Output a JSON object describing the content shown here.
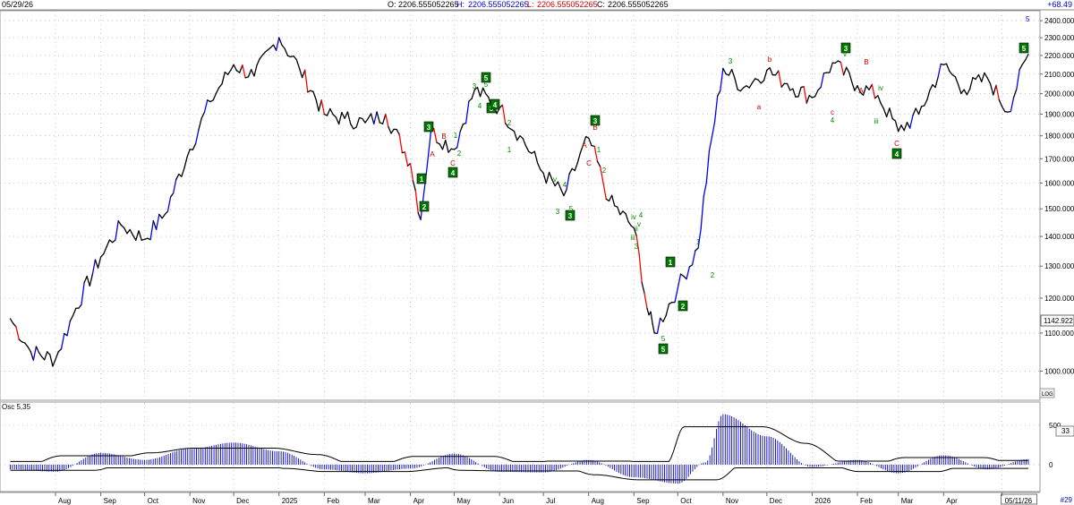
{
  "header": {
    "date": "05/29/26",
    "open_label": "O:",
    "open": "2206.555052265",
    "high_label": "H:",
    "high": "2206.555052265",
    "low_label": "L:",
    "low": "2206.555052265",
    "close_label": "C:",
    "close": "2206.555052265",
    "change": "+68.49"
  },
  "colors": {
    "up": "#0000ff",
    "down": "#ff0000",
    "neutral": "#000000",
    "wave_box": "#007700",
    "wave_green": "#008800",
    "wave_red": "#cc0000",
    "osc": "#0000cc",
    "grid": "#b8b8b8"
  },
  "price_panel": {
    "last_price_label": "1142.922",
    "log_badge": "LOG",
    "top_right_marker": "5",
    "right_edge": "+68.49"
  },
  "osc_panel": {
    "title": "Osc 5,35",
    "value_label": "33",
    "bottom_right": "#29"
  },
  "x_axis": {
    "labels": [
      "Aug",
      "Sep",
      "Oct",
      "Nov",
      "Dec",
      "2025",
      "Feb",
      "Mar",
      "Apr",
      "May",
      "Jun",
      "Jul",
      "Aug",
      "Sep",
      "Oct",
      "Nov",
      "Dec",
      "2026",
      "Feb",
      "Mar",
      "Apr",
      "05/11/26"
    ]
  },
  "chart_data": [
    {
      "type": "line",
      "scale": "log",
      "x": [
        "2024-07-01",
        "2024-07-15",
        "2024-08-01",
        "2024-08-15",
        "2024-09-01",
        "2024-09-15",
        "2024-10-01",
        "2024-10-15",
        "2024-11-01",
        "2024-11-15",
        "2024-12-01",
        "2024-12-15",
        "2025-01-01",
        "2025-01-15",
        "2025-02-01",
        "2025-02-15",
        "2025-03-01",
        "2025-03-15",
        "2025-04-01",
        "2025-04-08",
        "2025-04-15",
        "2025-05-01",
        "2025-05-15",
        "2025-06-01",
        "2025-06-15",
        "2025-07-01",
        "2025-07-15",
        "2025-08-01",
        "2025-08-15",
        "2025-09-01",
        "2025-09-10",
        "2025-09-15",
        "2025-10-01",
        "2025-10-15",
        "2025-11-01",
        "2025-11-15",
        "2025-12-01",
        "2025-12-15",
        "2026-01-01",
        "2026-01-15",
        "2026-02-01",
        "2026-02-15",
        "2026-03-01",
        "2026-03-15",
        "2026-04-01",
        "2026-04-15",
        "2026-05-01",
        "2026-05-15",
        "2026-05-29"
      ],
      "y": [
        1140,
        1050,
        1030,
        1170,
        1330,
        1440,
        1390,
        1480,
        1740,
        1960,
        2150,
        2090,
        2300,
        2130,
        1900,
        1880,
        1860,
        1900,
        1680,
        1460,
        1820,
        1740,
        2020,
        1930,
        1800,
        1640,
        1550,
        1790,
        1530,
        1430,
        1170,
        1100,
        1230,
        1360,
        2130,
        2030,
        2120,
        2050,
        1980,
        2160,
        2040,
        1990,
        1820,
        1900,
        2150,
        2020,
        2080,
        1910,
        2206.55
      ]
    },
    {
      "type": "bar",
      "name": "Osc 5,35",
      "x": [
        "2024-07-01",
        "2024-08-01",
        "2024-09-01",
        "2024-10-01",
        "2024-11-01",
        "2024-12-01",
        "2025-01-01",
        "2025-02-01",
        "2025-03-01",
        "2025-04-01",
        "2025-05-01",
        "2025-06-01",
        "2025-07-01",
        "2025-08-01",
        "2025-09-01",
        "2025-10-01",
        "2025-10-20",
        "2025-11-01",
        "2025-12-01",
        "2026-01-01",
        "2026-02-01",
        "2026-03-01",
        "2026-04-01",
        "2026-05-01",
        "2026-05-29"
      ],
      "values": [
        -60,
        -90,
        150,
        60,
        200,
        280,
        170,
        -60,
        -110,
        -50,
        140,
        -90,
        -100,
        60,
        -160,
        -240,
        30,
        640,
        360,
        -30,
        60,
        -110,
        120,
        -60,
        70
      ],
      "yticks": [
        500,
        0
      ],
      "bands": {
        "upper": "black",
        "lower": "black"
      }
    }
  ],
  "y_axis": {
    "ticks": [
      "2400.000",
      "2300.000",
      "2200.000",
      "2100.000",
      "2000.000",
      "1900.000",
      "1800.000",
      "1700.000",
      "1600.000",
      "1500.000",
      "1400.000",
      "1300.000",
      "1200.000",
      "1100.000",
      "1000.000"
    ],
    "osc_ticks": [
      "500",
      "0"
    ]
  },
  "waves": {
    "boxed": [
      "1",
      "2",
      "3",
      "4",
      "5",
      "5",
      "3",
      "4",
      "3",
      "1",
      "2",
      "5",
      "3",
      "4",
      "5"
    ],
    "green": [
      "3",
      "4",
      "5",
      "1",
      "2",
      "2",
      "1",
      "v",
      "3",
      "4",
      "5",
      "1",
      "2",
      "ii",
      "iii",
      "iv",
      "v",
      "1",
      "2",
      "3",
      "4",
      "5",
      "3",
      "4",
      "v",
      "iv",
      "iii"
    ],
    "red": [
      "A",
      "B",
      "C",
      "A",
      "B",
      "C",
      "a",
      "b",
      "c",
      "B",
      "A",
      "C"
    ]
  }
}
